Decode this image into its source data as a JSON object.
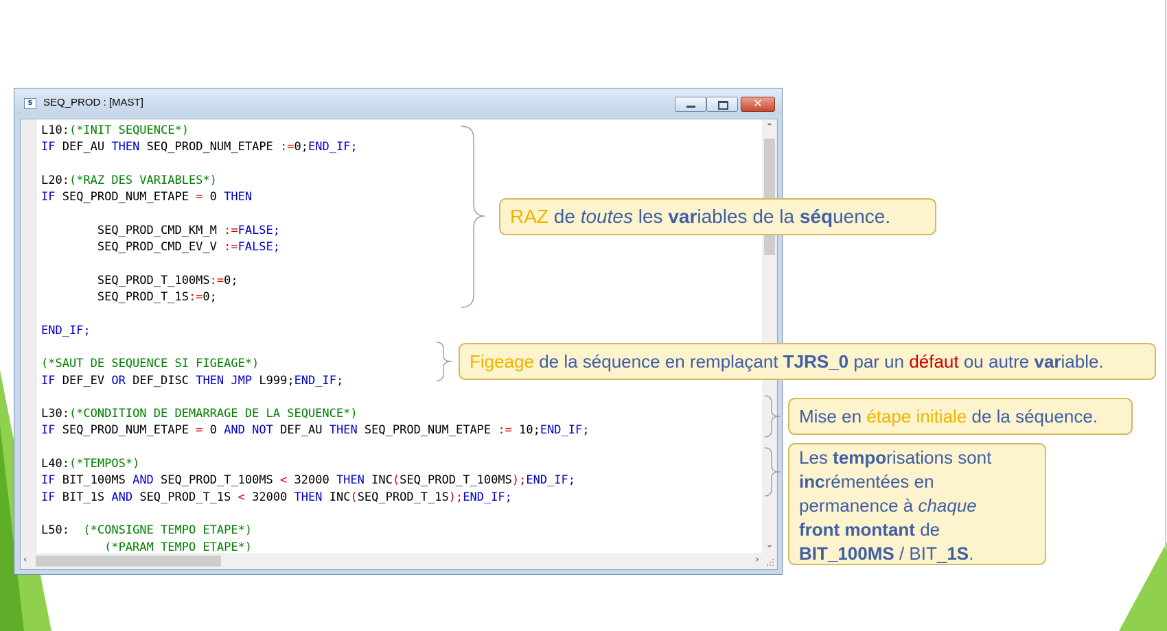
{
  "window": {
    "title": "SEQ_PROD : [MAST]",
    "icon": "st-editor-icon",
    "minimize_icon": "minimize-icon",
    "maximize_icon": "maximize-icon",
    "close_icon": "close-icon",
    "close_glyph": "✕"
  },
  "code_lines": [
    {
      "tokens": [
        {
          "t": "L10:",
          "c": "n"
        },
        {
          "t": "(*INIT SEQUENCE*)",
          "c": "c"
        }
      ]
    },
    {
      "tokens": [
        {
          "t": "IF",
          "c": "k"
        },
        {
          "t": " DEF_AU ",
          "c": "v"
        },
        {
          "t": "THEN",
          "c": "k"
        },
        {
          "t": " SEQ_PROD_NUM_ETAPE ",
          "c": "v"
        },
        {
          "t": ":=",
          "c": "o"
        },
        {
          "t": "0;",
          "c": "v"
        },
        {
          "t": "END_IF;",
          "c": "k"
        }
      ]
    },
    {
      "tokens": []
    },
    {
      "tokens": [
        {
          "t": "L20:",
          "c": "n"
        },
        {
          "t": "(*RAZ DES VARIABLES*)",
          "c": "c"
        }
      ]
    },
    {
      "tokens": [
        {
          "t": "IF",
          "c": "k"
        },
        {
          "t": " SEQ_PROD_NUM_ETAPE ",
          "c": "v"
        },
        {
          "t": "=",
          "c": "o"
        },
        {
          "t": " 0 ",
          "c": "v"
        },
        {
          "t": "THEN",
          "c": "k"
        }
      ]
    },
    {
      "tokens": []
    },
    {
      "tokens": [
        {
          "t": "        SEQ_PROD_CMD_KM_M ",
          "c": "v"
        },
        {
          "t": ":=",
          "c": "o"
        },
        {
          "t": "FALSE;",
          "c": "l"
        }
      ]
    },
    {
      "tokens": [
        {
          "t": "        SEQ_PROD_CMD_EV_V ",
          "c": "v"
        },
        {
          "t": ":=",
          "c": "o"
        },
        {
          "t": "FALSE;",
          "c": "l"
        }
      ]
    },
    {
      "tokens": []
    },
    {
      "tokens": [
        {
          "t": "        SEQ_PROD_T_100MS",
          "c": "v"
        },
        {
          "t": ":=",
          "c": "o"
        },
        {
          "t": "0;",
          "c": "v"
        }
      ]
    },
    {
      "tokens": [
        {
          "t": "        SEQ_PROD_T_1S",
          "c": "v"
        },
        {
          "t": ":=",
          "c": "o"
        },
        {
          "t": "0;",
          "c": "v"
        }
      ]
    },
    {
      "tokens": []
    },
    {
      "tokens": [
        {
          "t": "END_IF;",
          "c": "k"
        }
      ]
    },
    {
      "tokens": []
    },
    {
      "tokens": [
        {
          "t": "(*SAUT DE SEQUENCE SI FIGEAGE*)",
          "c": "c"
        }
      ]
    },
    {
      "tokens": [
        {
          "t": "IF",
          "c": "k"
        },
        {
          "t": " DEF_EV ",
          "c": "v"
        },
        {
          "t": "OR",
          "c": "k"
        },
        {
          "t": " DEF_DISC ",
          "c": "v"
        },
        {
          "t": "THEN",
          "c": "k"
        },
        {
          "t": " ",
          "c": "v"
        },
        {
          "t": "JMP",
          "c": "k"
        },
        {
          "t": " L999;",
          "c": "v"
        },
        {
          "t": "END_IF;",
          "c": "k"
        }
      ]
    },
    {
      "tokens": []
    },
    {
      "tokens": [
        {
          "t": "L30:",
          "c": "n"
        },
        {
          "t": "(*CONDITION DE DEMARRAGE DE LA SEQUENCE*)",
          "c": "c"
        }
      ]
    },
    {
      "tokens": [
        {
          "t": "IF",
          "c": "k"
        },
        {
          "t": " SEQ_PROD_NUM_ETAPE ",
          "c": "v"
        },
        {
          "t": "=",
          "c": "o"
        },
        {
          "t": " 0 ",
          "c": "v"
        },
        {
          "t": "AND",
          "c": "k"
        },
        {
          "t": " ",
          "c": "v"
        },
        {
          "t": "NOT",
          "c": "k"
        },
        {
          "t": " DEF_AU ",
          "c": "v"
        },
        {
          "t": "THEN",
          "c": "k"
        },
        {
          "t": " SEQ_PROD_NUM_ETAPE ",
          "c": "v"
        },
        {
          "t": ":=",
          "c": "o"
        },
        {
          "t": " 10;",
          "c": "v"
        },
        {
          "t": "END_IF;",
          "c": "k"
        }
      ]
    },
    {
      "tokens": []
    },
    {
      "tokens": [
        {
          "t": "L40:",
          "c": "n"
        },
        {
          "t": "(*TEMPOS*)",
          "c": "c"
        }
      ]
    },
    {
      "tokens": [
        {
          "t": "IF",
          "c": "k"
        },
        {
          "t": " BIT_100MS ",
          "c": "v"
        },
        {
          "t": "AND",
          "c": "k"
        },
        {
          "t": " SEQ_PROD_T_100MS ",
          "c": "v"
        },
        {
          "t": "<",
          "c": "o"
        },
        {
          "t": " 32000 ",
          "c": "v"
        },
        {
          "t": "THEN",
          "c": "k"
        },
        {
          "t": " INC",
          "c": "v"
        },
        {
          "t": "(",
          "c": "o"
        },
        {
          "t": "SEQ_PROD_T_100MS",
          "c": "v"
        },
        {
          "t": ");",
          "c": "o"
        },
        {
          "t": "END_IF;",
          "c": "k"
        }
      ]
    },
    {
      "tokens": [
        {
          "t": "IF",
          "c": "k"
        },
        {
          "t": " BIT_1S ",
          "c": "v"
        },
        {
          "t": "AND",
          "c": "k"
        },
        {
          "t": " SEQ_PROD_T_1S ",
          "c": "v"
        },
        {
          "t": "<",
          "c": "o"
        },
        {
          "t": " 32000 ",
          "c": "v"
        },
        {
          "t": "THEN",
          "c": "k"
        },
        {
          "t": " INC",
          "c": "v"
        },
        {
          "t": "(",
          "c": "o"
        },
        {
          "t": "SEQ_PROD_T_1S",
          "c": "v"
        },
        {
          "t": ");",
          "c": "o"
        },
        {
          "t": "END_IF;",
          "c": "k"
        }
      ]
    },
    {
      "tokens": []
    },
    {
      "tokens": [
        {
          "t": "L50:",
          "c": "n"
        },
        {
          "t": "  (*CONSIGNE TEMPO ETAPE*)",
          "c": "c"
        }
      ]
    },
    {
      "tokens": [
        {
          "t": "         (*PARAM TEMPO ETAPE*)",
          "c": "c"
        }
      ]
    }
  ],
  "callouts": {
    "raz": {
      "p1": "RAZ",
      "p2": " de ",
      "p3": "toutes",
      "p4": " les ",
      "p5": "var",
      "p6": "iables de la ",
      "p7": "séq",
      "p8": "uence."
    },
    "figeage": {
      "p1": "Figeage",
      "p2": " de la séquence en remplaçant ",
      "p3": "TJRS_0",
      "p4": " par un ",
      "p5": "défaut",
      "p6": " ou autre ",
      "p7": "var",
      "p8": "iable."
    },
    "init": {
      "p1": "Mise en ",
      "p2": "étape initiale",
      "p3": " de la séquence."
    },
    "tempo": {
      "p1": "Les ",
      "p2": "tempo",
      "p3": "risations sont",
      "p4": "inc",
      "p5": "rémentées en",
      "p6": "permanence à ",
      "p7": "chaque",
      "p8": "front montant",
      "p9": " de",
      "p10": "BIT_100MS",
      "p11": " / BIT_",
      "p12": "1S",
      "p13": "."
    }
  },
  "scroll": {
    "up_arrow": "⌃",
    "down_arrow": "⌄",
    "left_arrow": "‹",
    "right_arrow": "›",
    "grip_icon": "resize-grip-icon"
  },
  "colors": {
    "keyword": "#0000cc",
    "comment": "#008000",
    "operator": "#cc0000",
    "callout_bg": "#fdf3cc",
    "callout_border": "#d4b95e",
    "deco_green": "#8ccc3c"
  }
}
